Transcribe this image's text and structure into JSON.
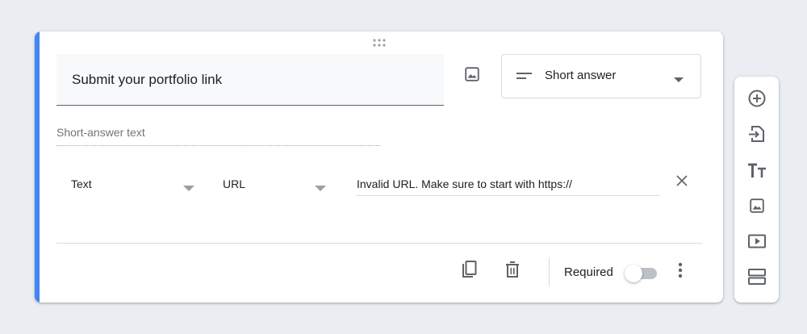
{
  "question": {
    "title": "Submit your portfolio link",
    "type_label": "Short answer",
    "answer_placeholder": "Short-answer text"
  },
  "validation": {
    "type_value": "Text",
    "kind_value": "URL",
    "error_text": "Invalid URL. Make sure to start with https://"
  },
  "footer": {
    "required_label": "Required",
    "required_on": false
  },
  "icons": {
    "drag": "drag-handle-icon",
    "image": "image-icon",
    "type": "short-answer-lines-icon",
    "dropdown": "dropdown-arrow-icon",
    "close": "close-icon",
    "copy": "copy-icon",
    "delete": "trash-icon",
    "more": "more-vert-icon"
  },
  "side_toolbar": [
    {
      "name": "add-question",
      "icon": "plus-circle-icon"
    },
    {
      "name": "import-questions",
      "icon": "import-icon"
    },
    {
      "name": "add-title",
      "icon": "title-text-icon"
    },
    {
      "name": "add-image",
      "icon": "image-icon"
    },
    {
      "name": "add-video",
      "icon": "video-icon"
    },
    {
      "name": "add-section",
      "icon": "section-icon"
    }
  ],
  "colors": {
    "accent": "#4285f4",
    "background": "#eaeef2",
    "text": "#202124",
    "secondary_text": "#70757a",
    "icon": "#5f6368"
  }
}
